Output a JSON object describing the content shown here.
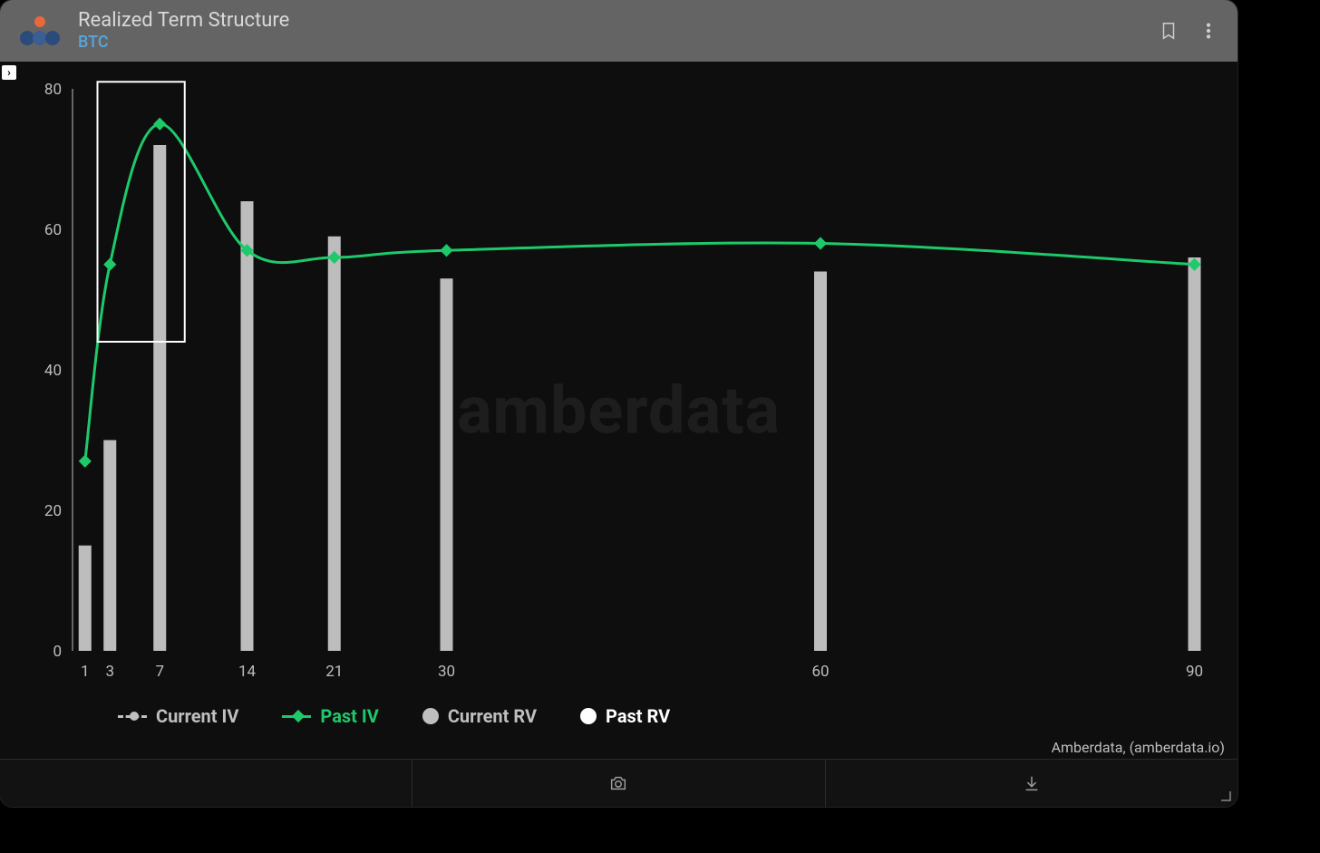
{
  "header": {
    "title": "Realized Term Structure",
    "subtitle": "BTC"
  },
  "icons": {
    "bookmark": "bookmark-icon",
    "menu": "more-vertical-icon",
    "camera": "camera-icon",
    "download": "download-icon"
  },
  "attribution": "Amberdata, (amberdata.io)",
  "legend": [
    {
      "key": "current_iv",
      "label": "Current IV",
      "style": "dashed",
      "color": "#bfbfbf"
    },
    {
      "key": "past_iv",
      "label": "Past IV",
      "style": "line",
      "color": "#1ec96a"
    },
    {
      "key": "current_rv",
      "label": "Current RV",
      "style": "dot",
      "color": "#bfbfbf"
    },
    {
      "key": "past_rv",
      "label": "Past RV",
      "style": "dot",
      "color": "#ffffff"
    }
  ],
  "chart_data": {
    "type": "bar+line",
    "x_categories": [
      1,
      3,
      7,
      14,
      21,
      30,
      60,
      90
    ],
    "ylim": [
      0,
      80
    ],
    "y_ticks": [
      0,
      20,
      40,
      60,
      80
    ],
    "series": [
      {
        "name": "Past RV",
        "role": "bars",
        "color": "#bfbfbf",
        "values": [
          15,
          30,
          72,
          64,
          59,
          53,
          54,
          56
        ]
      },
      {
        "name": "Past IV",
        "role": "line",
        "color": "#1ec96a",
        "values": [
          27,
          55,
          75,
          57,
          56,
          57,
          58,
          55
        ]
      }
    ],
    "highlight_box": {
      "x_range": [
        2,
        9
      ],
      "y_range": [
        44,
        81
      ],
      "note": "white rectangle around x≈3–7 region"
    },
    "title": "Realized Term Structure",
    "xlabel": "",
    "ylabel": ""
  },
  "colors": {
    "bg": "#0e0e0e",
    "titlebar": "#646464",
    "accent_green": "#1ec96a",
    "bar_gray": "#bfbfbf",
    "subtitle_blue": "#56a6e0"
  }
}
